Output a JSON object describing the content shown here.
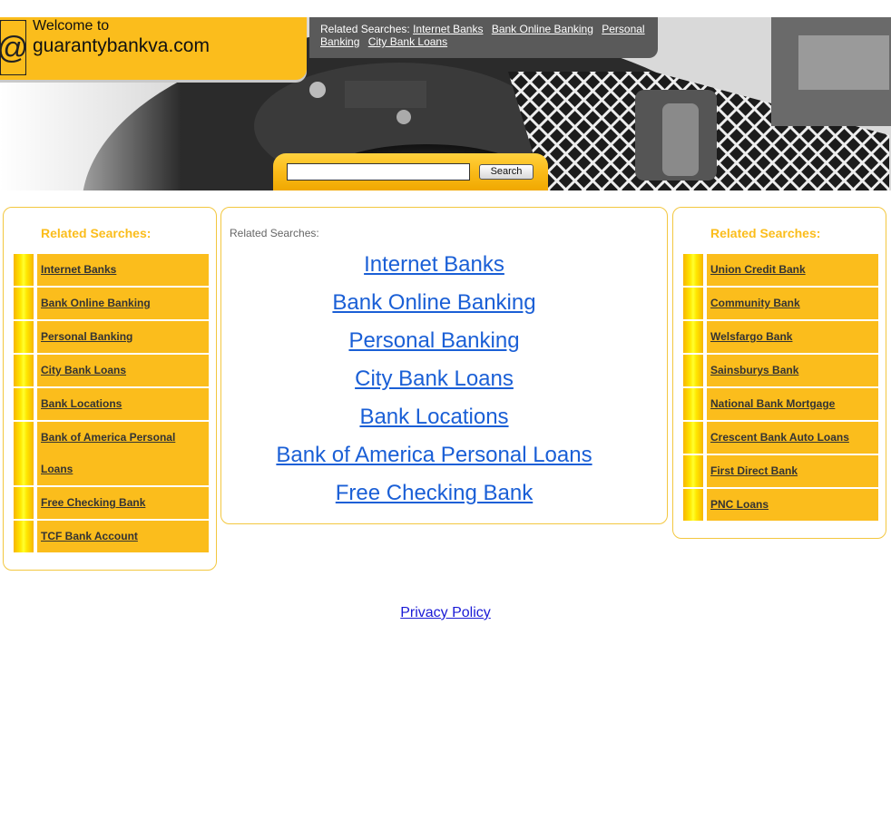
{
  "header": {
    "welcome": "Welcome to",
    "site_name": "guarantybankva.com",
    "related_label": "Related Searches:",
    "related_links": [
      "Internet Banks",
      "Bank Online Banking",
      "Personal Banking",
      "City Bank Loans"
    ],
    "logo_icon": "at-sign-icon",
    "background_image": "typewriter-photo"
  },
  "search": {
    "value": "",
    "button_label": "Search"
  },
  "left_panel": {
    "title": "Related Searches:",
    "items": [
      "Internet Banks",
      "Bank Online Banking",
      "Personal Banking",
      "City Bank Loans",
      "Bank Locations",
      "Bank of America Personal Loans",
      "Free Checking Bank",
      "TCF Bank Account"
    ]
  },
  "center_panel": {
    "title": "Related Searches:",
    "items": [
      "Internet Banks",
      "Bank Online Banking",
      "Personal Banking",
      "City Bank Loans",
      "Bank Locations",
      "Bank of America Personal Loans",
      "Free Checking Bank"
    ]
  },
  "right_panel": {
    "title": "Related Searches:",
    "items": [
      "Union Credit Bank",
      "Community Bank",
      "Welsfargo Bank",
      "Sainsburys Bank",
      "National Bank Mortgage",
      "Crescent Bank Auto Loans",
      "First Direct Bank",
      "PNC Loans"
    ]
  },
  "footer": {
    "privacy_label": "Privacy Policy"
  },
  "colors": {
    "accent": "#fbbd1c",
    "link_blue": "#1a5fd6",
    "header_gray": "#5a5a5a",
    "box_border": "#f3c73f"
  }
}
